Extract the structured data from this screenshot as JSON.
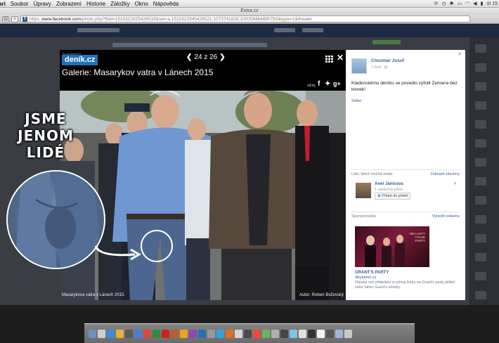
{
  "menubar": {
    "items": [
      "ari",
      "Soubor",
      "Úpravy",
      "Zobrazení",
      "Historie",
      "Záložky",
      "Okno",
      "Nápověda"
    ],
    "clock": "út 15"
  },
  "browser": {
    "window_title": "Extra.cz",
    "url_domain": "www.facebook.com",
    "url_rest": "/photo.php?fbid=1515322825426533&set=a.1515322945426521.1073741828.100008464890783&type=1&theater"
  },
  "photo": {
    "logo_small": "SLAVNOSTI",
    "logo": "deník.cz",
    "gallery_title": "Galerie: Masarykov vatra v Lánech 2015",
    "pager": "24 z 26",
    "share_label": "sdílej",
    "caption": "Masarykova vatra v Lánech 2015.",
    "author": "Autor: Robert Božovský"
  },
  "overlay": {
    "lines": [
      "JSME",
      "JENOM",
      "LIDÉ"
    ]
  },
  "side": {
    "poster_name": "Chozmar Jusuf",
    "poster_time": "1 hod · ◍",
    "post_text": "Kladenskému deníku se povedlo vyfotit Zemana bez trenek!",
    "like_label": "Sdílet",
    "people_label": "Lidé, které možná znáte",
    "people_link": "Zobrazit všechny",
    "friend_name": "Anet Janicova",
    "friend_mutual": "1 společný přítel",
    "add_friend": "Přidat do přátel",
    "sponsored_label": "Sponzorováno",
    "create_ad": "Vytvořit reklamu",
    "ad_image_text": "NEJ LISTY TVOJE PARTY",
    "ad_title": "GRANT'S PARTY",
    "ad_domain": "dikykamo.cz",
    "ad_desc": "Otestuj své přátelství a vyhraj lístky na Grant's party přátel nebo láhev Grant's whisky."
  },
  "colors": {
    "facebook_blue": "#3b5998",
    "denik_blue": "#1d72ba"
  }
}
